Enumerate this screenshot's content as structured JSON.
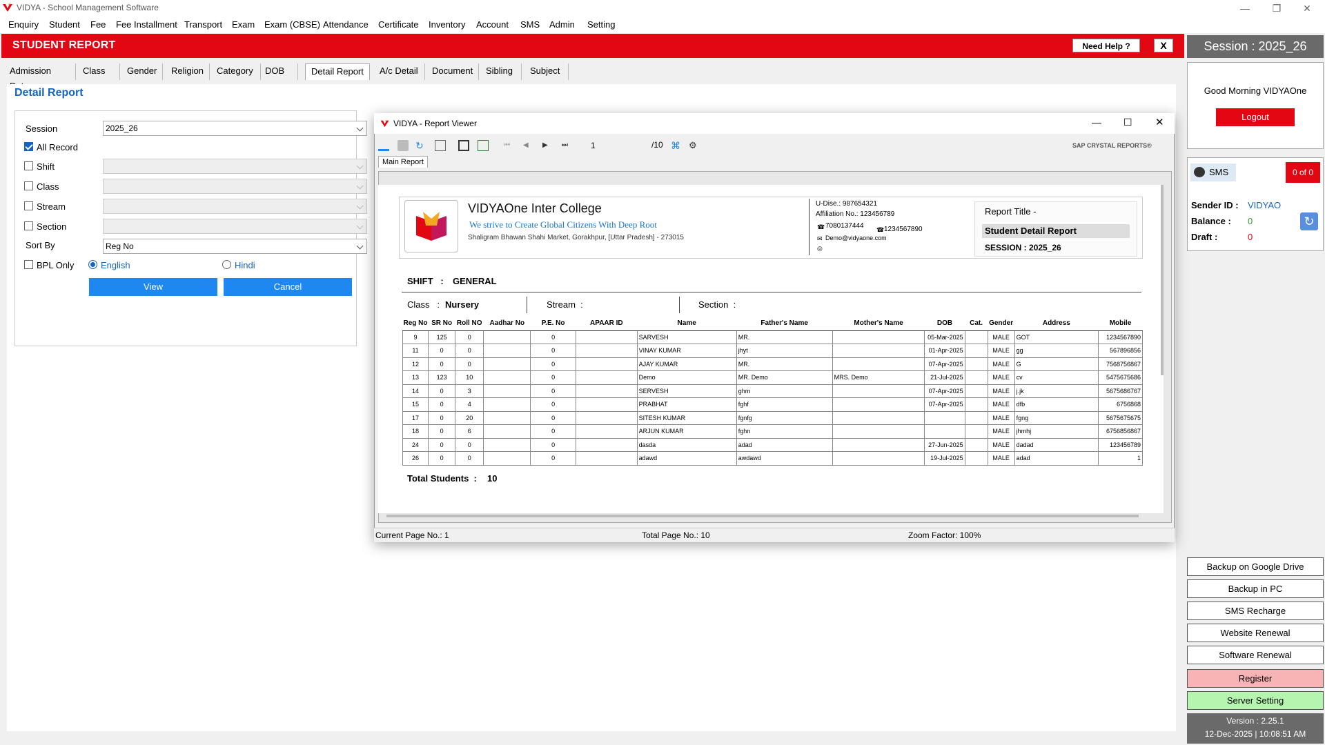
{
  "app": {
    "title": "VIDYA - School Management Software"
  },
  "menu": [
    "Enquiry",
    "Student",
    "Fee",
    "Fee Installment",
    "Transport",
    "Exam",
    "Exam (CBSE)",
    "Attendance",
    "Certificate",
    "Inventory",
    "Account",
    "SMS",
    "Admin",
    "Setting"
  ],
  "header": {
    "title": "STUDENT REPORT",
    "help": "Need Help ?",
    "close": "X"
  },
  "tabs": [
    "Admission Date",
    "Class",
    "Gender",
    "Religion",
    "Category",
    "DOB",
    "Detail Report",
    "A/c Detail",
    "Document",
    "Sibling",
    "Subject"
  ],
  "active_tab": "Detail Report",
  "form": {
    "title": "Detail Report",
    "session_label": "Session",
    "session_value": "2025_26",
    "all_record": "All Record",
    "shift": "Shift",
    "class": "Class",
    "stream": "Stream",
    "section": "Section",
    "sort_by_label": "Sort By",
    "sort_by_value": "Reg No",
    "bpl_only": "BPL Only",
    "lang_english": "English",
    "lang_hindi": "Hindi",
    "view": "View",
    "cancel": "Cancel"
  },
  "right": {
    "session": "Session : 2025_26",
    "greeting": "Good Morning VIDYAOne",
    "logout": "Logout",
    "sms": "SMS",
    "sms_count": "0  of  0",
    "sender_label": "Sender ID :",
    "sender_value": "VIDYAO",
    "balance_label": "Balance :",
    "balance_value": "0",
    "draft_label": "Draft :",
    "draft_value": "0",
    "buttons": [
      "Backup on Google Drive",
      "Backup in PC",
      "SMS Recharge",
      "Website Renewal",
      "Software Renewal",
      "Register",
      "Server Setting"
    ],
    "version": "Version : 2.25.1",
    "datetime": "12-Dec-2025 | 10:08:51 AM"
  },
  "viewer": {
    "title": "VIDYA - Report Viewer",
    "page": "1",
    "total": "/10",
    "brand": "SAP CRYSTAL REPORTS®",
    "tab": "Main Report",
    "status_current": "Current Page No.: 1",
    "status_total": "Total Page No.: 10",
    "status_zoom": "Zoom Factor: 100%"
  },
  "report": {
    "school": "VIDYAOne Inter College",
    "tagline": "We strive to Create Global Citizens With Deep Root",
    "address": "Shaligram Bhawan Shahi Market, Gorakhpur, [Uttar Pradesh] - 273015",
    "udise": "U-Dise.: 987654321",
    "affiliation": "Affiliation No.: 123456789",
    "phone1": "7080137444",
    "phone2": "1234567890",
    "email": "Demo@vidyaone.com",
    "report_title_label": "Report Title -",
    "report_title": "Student Detail Report",
    "session": "SESSION : 2025_26",
    "shift_label": "SHIFT   :",
    "shift_value": "GENERAL",
    "class_label": "Class   :",
    "class_value": "Nursery",
    "stream_label": "Stream  :",
    "section_label": "Section  :",
    "columns": [
      "Reg No",
      "SR No",
      "Roll NO",
      "Aadhar No",
      "P.E. No",
      "APAAR ID",
      "Name",
      "Father's Name",
      "Mother's Name",
      "DOB",
      "Cat.",
      "Gender",
      "Address",
      "Mobile"
    ],
    "rows": [
      [
        "9",
        "125",
        "0",
        "",
        "0",
        "",
        "SARVESH",
        "MR.",
        "",
        "05-Mar-2025",
        "",
        "MALE",
        "GOT",
        "1234567890"
      ],
      [
        "11",
        "0",
        "0",
        "",
        "0",
        "",
        "VINAY KUMAR",
        "jhyt",
        "",
        "01-Apr-2025",
        "",
        "MALE",
        "gg",
        "567896856"
      ],
      [
        "12",
        "0",
        "0",
        "",
        "0",
        "",
        "AJAY KUMAR",
        "MR.",
        "",
        "07-Apr-2025",
        "",
        "MALE",
        "G",
        "7568756867"
      ],
      [
        "13",
        "123",
        "10",
        "",
        "0",
        "",
        "Demo",
        "MR. Demo",
        "MRS. Demo",
        "21-Jul-2025",
        "",
        "MALE",
        "cv",
        "5475675686"
      ],
      [
        "14",
        "0",
        "3",
        "",
        "0",
        "",
        "SERVESH",
        "ghm",
        "",
        "07-Apr-2025",
        "",
        "MALE",
        "j.jk",
        "5675686767"
      ],
      [
        "15",
        "0",
        "4",
        "",
        "0",
        "",
        "PRABHAT",
        "fghf",
        "",
        "07-Apr-2025",
        "",
        "MALE",
        "dfb",
        "6756868"
      ],
      [
        "17",
        "0",
        "20",
        "",
        "0",
        "",
        "SITESH KUMAR",
        "fgnfg",
        "",
        "",
        "",
        "MALE",
        "fgng",
        "5675675675"
      ],
      [
        "18",
        "0",
        "6",
        "",
        "0",
        "",
        "ARJUN KUMAR",
        "fghn",
        "",
        "",
        "",
        "MALE",
        "jhmhj",
        "6756856867"
      ],
      [
        "24",
        "0",
        "0",
        "",
        "0",
        "",
        "dasda",
        "adad",
        "",
        "27-Jun-2025",
        "",
        "MALE",
        "dadad",
        "123456789"
      ],
      [
        "26",
        "0",
        "0",
        "",
        "0",
        "",
        "adawd",
        "awdawd",
        "",
        "19-Jul-2025",
        "",
        "MALE",
        "adad",
        "1"
      ]
    ],
    "total_label": "Total Students  :",
    "total_value": "10"
  },
  "colors": {
    "red": "#e30613",
    "blue": "#1e88f0",
    "link": "#1565c0"
  }
}
